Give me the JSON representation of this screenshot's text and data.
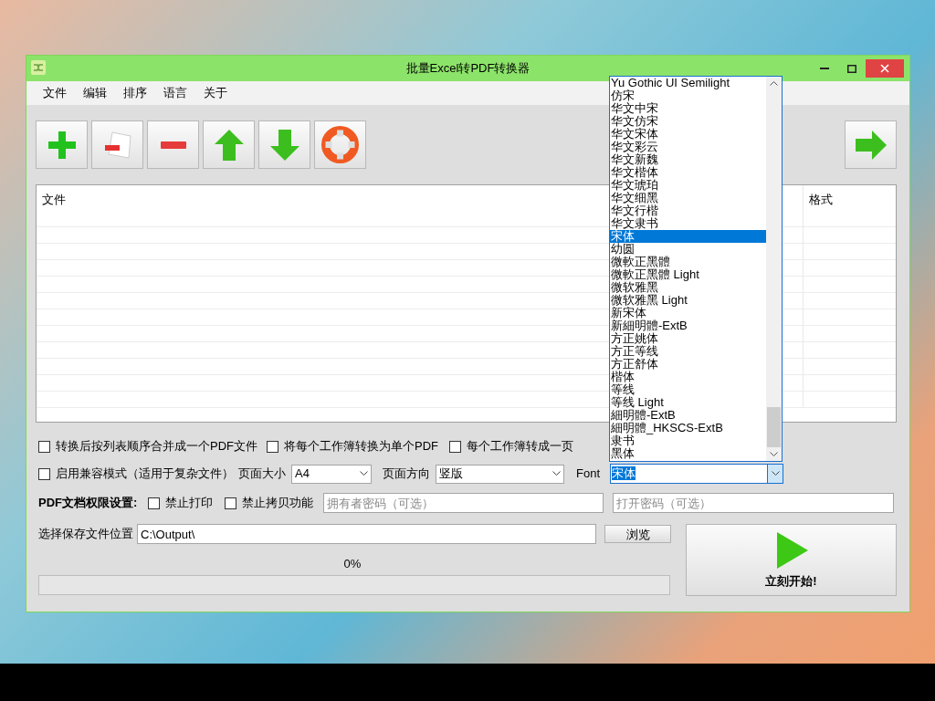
{
  "window": {
    "title": "批量Excel转PDF转换器"
  },
  "menu": [
    "文件",
    "编辑",
    "排序",
    "语言",
    "关于"
  ],
  "toolbar": [
    {
      "kind": "add"
    },
    {
      "kind": "remove-file"
    },
    {
      "kind": "remove"
    },
    {
      "kind": "up"
    },
    {
      "kind": "down"
    },
    {
      "kind": "help"
    },
    {
      "kind": "next"
    }
  ],
  "table": {
    "columns": [
      "文件",
      "格式"
    ]
  },
  "options": [
    {
      "label": "转换后按列表顺序合并成一个PDF文件",
      "checked": false
    },
    {
      "label": "将每个工作簿转换为单个PDF",
      "checked": false
    },
    {
      "label": "每个工作簿转成一页",
      "checked": false
    },
    {
      "label": "启用兼容模式（适用于复杂文件）",
      "checked": false
    }
  ],
  "page_size": {
    "label": "页面大小",
    "value": "A4"
  },
  "orientation": {
    "label": "页面方向",
    "value": "竖版"
  },
  "font": {
    "label": "Font",
    "value": "宋体",
    "options": [
      {
        "label": "Yu Gothic UI Semilight",
        "selected": false
      },
      {
        "label": "仿宋",
        "selected": false
      },
      {
        "label": "华文中宋",
        "selected": false
      },
      {
        "label": "华文仿宋",
        "selected": false
      },
      {
        "label": "华文宋体",
        "selected": false
      },
      {
        "label": "华文彩云",
        "selected": false
      },
      {
        "label": "华文新魏",
        "selected": false
      },
      {
        "label": "华文楷体",
        "selected": false
      },
      {
        "label": "华文琥珀",
        "selected": false
      },
      {
        "label": "华文细黑",
        "selected": false
      },
      {
        "label": "华文行楷",
        "selected": false
      },
      {
        "label": "华文隶书",
        "selected": false
      },
      {
        "label": "宋体",
        "selected": true
      },
      {
        "label": "幼圆",
        "selected": false
      },
      {
        "label": "微軟正黑體",
        "selected": false
      },
      {
        "label": "微軟正黑體 Light",
        "selected": false
      },
      {
        "label": "微软雅黑",
        "selected": false
      },
      {
        "label": "微软雅黑 Light",
        "selected": false
      },
      {
        "label": "新宋体",
        "selected": false
      },
      {
        "label": "新細明體-ExtB",
        "selected": false
      },
      {
        "label": "方正姚体",
        "selected": false
      },
      {
        "label": "方正等线",
        "selected": false
      },
      {
        "label": "方正舒体",
        "selected": false
      },
      {
        "label": "楷体",
        "selected": false
      },
      {
        "label": "等线",
        "selected": false
      },
      {
        "label": "等线 Light",
        "selected": false
      },
      {
        "label": "細明體-ExtB",
        "selected": false
      },
      {
        "label": "細明體_HKSCS-ExtB",
        "selected": false
      },
      {
        "label": "隶书",
        "selected": false
      },
      {
        "label": "黑体",
        "selected": false
      }
    ]
  },
  "permissions": {
    "label": "PDF文档权限设置:",
    "options": [
      {
        "label": "禁止打印",
        "checked": false
      },
      {
        "label": "禁止拷贝功能",
        "checked": false
      }
    ],
    "owner_password": {
      "placeholder": "拥有者密码（可选）"
    },
    "open_password": {
      "placeholder": "打开密码（可选）"
    }
  },
  "output": {
    "label": "选择保存文件位置",
    "value": "C:\\Output\\",
    "browse_button": "浏览"
  },
  "progress": {
    "reading": "0%",
    "level": 0
  },
  "start_button": "立刻开始!"
}
